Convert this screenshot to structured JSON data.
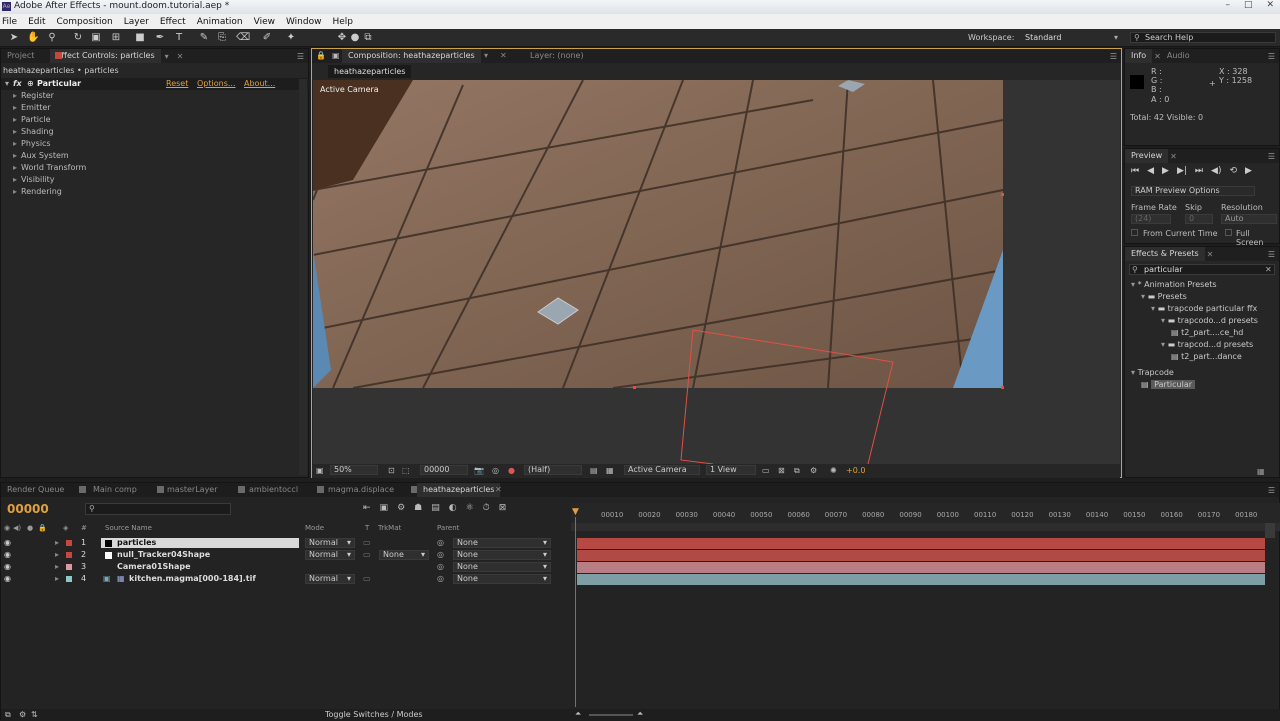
{
  "window": {
    "title": "Adobe After Effects - mount.doom.tutorial.aep *"
  },
  "menu": [
    "File",
    "Edit",
    "Composition",
    "Layer",
    "Effect",
    "Animation",
    "View",
    "Window",
    "Help"
  ],
  "toolbar": {
    "workspace_label": "Workspace:",
    "workspace_value": "Standard",
    "search_placeholder": "Search Help"
  },
  "effect_controls": {
    "tab_project": "Project",
    "tab_label": "Effect Controls: particles",
    "breadcrumb": "heathazeparticles • particles",
    "effect_name": "Particular",
    "reset": "Reset",
    "options": "Options...",
    "about": "About...",
    "groups": [
      "Register",
      "Emitter",
      "Particle",
      "Shading",
      "Physics",
      "Aux System",
      "World Transform",
      "Visibility",
      "Rendering"
    ]
  },
  "composition": {
    "tab_label": "Composition: heathazeparticles",
    "layer_tab": "Layer: (none)",
    "subtab": "heathazeparticles",
    "camera_label": "Active Camera",
    "footer": {
      "zoom": "50%",
      "timecode": "00000",
      "resolution": "(Half)",
      "camera": "Active Camera",
      "views": "1 View",
      "exposure": "+0.0"
    }
  },
  "info": {
    "tab": "Info",
    "tab2": "Audio",
    "r": "R :",
    "g": "G :",
    "b": "B :",
    "a": "A : 0",
    "x": "X : 328",
    "y": "Y : 1258",
    "total": "Total: 42  Visible: 0"
  },
  "preview": {
    "tab": "Preview",
    "ram": "RAM Preview Options",
    "frame_rate_label": "Frame Rate",
    "skip_label": "Skip",
    "resolution_label": "Resolution",
    "frame_rate": "(24)",
    "skip": "0",
    "resolution": "Auto",
    "from_current": "From Current Time",
    "full_screen": "Full Screen"
  },
  "effects_presets": {
    "tab": "Effects & Presets",
    "search": "particular",
    "tree": [
      {
        "label": "* Animation Presets",
        "indent": 0
      },
      {
        "label": "Presets",
        "indent": 1
      },
      {
        "label": "trapcode particular ffx",
        "indent": 2
      },
      {
        "label": "trapcodo...d presets",
        "indent": 3
      },
      {
        "label": "t2_part....ce_hd",
        "indent": 4
      },
      {
        "label": "trapcod...d presets",
        "indent": 3
      },
      {
        "label": "t2_part...dance",
        "indent": 4
      },
      {
        "label": "Trapcode",
        "indent": 0
      },
      {
        "label": "Particular",
        "indent": 1
      }
    ]
  },
  "timeline": {
    "tabs": [
      "Render Queue",
      "Main comp",
      "masterLayer",
      "ambientoccl",
      "magma.displace",
      "heathazeparticles"
    ],
    "timecode": "00000",
    "columns": {
      "source": "Source Name",
      "mode": "Mode",
      "t": "T",
      "trkmat": "TrkMat",
      "parent": "Parent"
    },
    "layers": [
      {
        "num": "1",
        "name": "particles",
        "mode": "Normal",
        "trkmat": "",
        "parent": "None",
        "color": "#c8473d",
        "bar": "#b64a42"
      },
      {
        "num": "2",
        "name": "null_Tracker04Shape",
        "mode": "Normal",
        "trkmat": "None",
        "parent": "None",
        "color": "#c8473d",
        "bar": "#b04a44"
      },
      {
        "num": "3",
        "name": "Camera01Shape",
        "mode": "",
        "trkmat": "",
        "parent": "None",
        "color": "#d99aa0",
        "bar": "#b87e83"
      },
      {
        "num": "4",
        "name": "kitchen.magma[000-184].tif",
        "mode": "Normal",
        "trkmat": "",
        "parent": "None",
        "color": "#8cc9c9",
        "bar": "#7c9ea4"
      }
    ],
    "ticks": [
      "00010",
      "00020",
      "00030",
      "00040",
      "00050",
      "00060",
      "00070",
      "00080",
      "00090",
      "00100",
      "00110",
      "00120",
      "00130",
      "00140",
      "00150",
      "00160",
      "00170",
      "00180"
    ],
    "footer": "Toggle Switches / Modes"
  }
}
